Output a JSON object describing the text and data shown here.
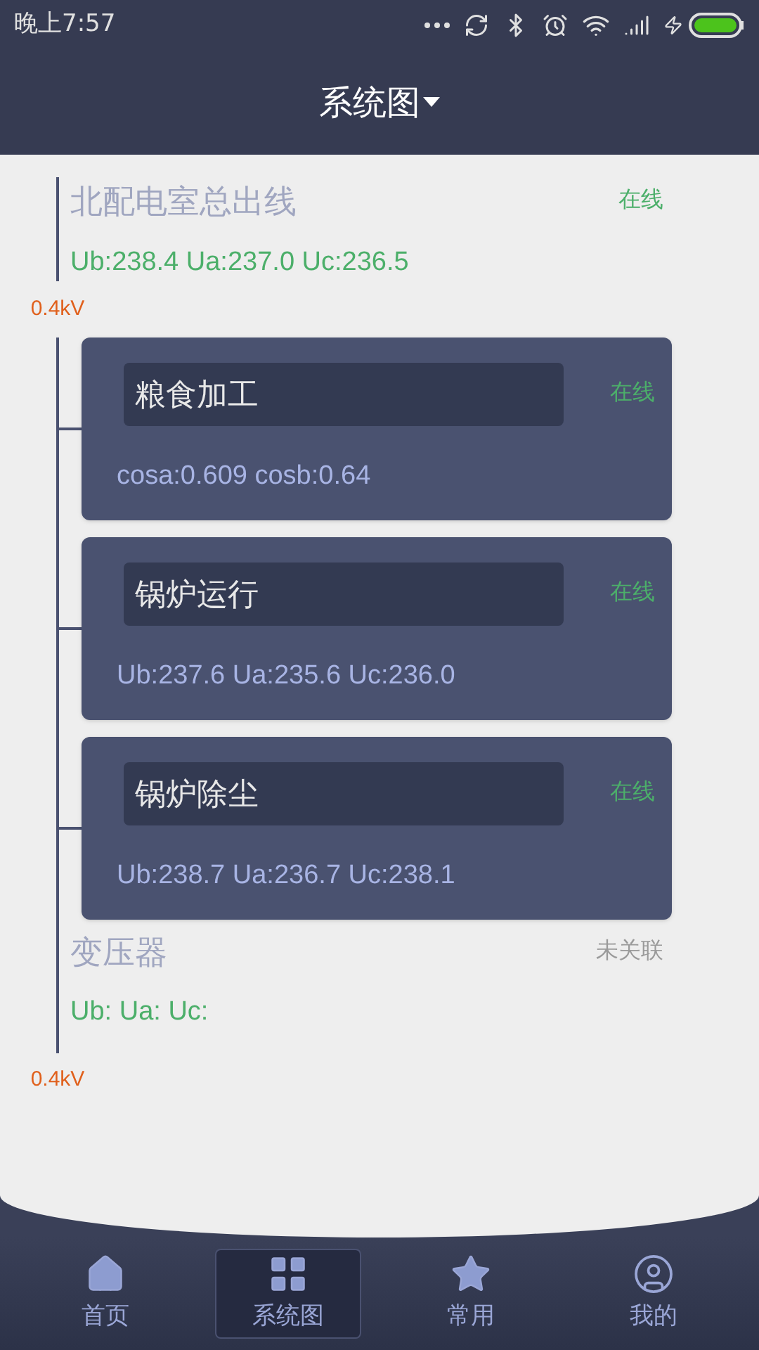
{
  "status_bar": {
    "time": "晚上7:57"
  },
  "header": {
    "title": "系统图"
  },
  "top_feeder": {
    "name": "北配电室总出线",
    "status": "在线",
    "online": true,
    "readings": "Ub:238.4 Ua:237.0 Uc:236.5",
    "bus_label": "0.4kV"
  },
  "loads": [
    {
      "name": "粮食加工",
      "status": "在线",
      "online": true,
      "readings": "cosa:0.609 cosb:0.64"
    },
    {
      "name": "锅炉运行",
      "status": "在线",
      "online": true,
      "readings": "Ub:237.6 Ua:235.6 Uc:236.0"
    },
    {
      "name": "锅炉除尘",
      "status": "在线",
      "online": true,
      "readings": "Ub:238.7 Ua:236.7 Uc:238.1"
    }
  ],
  "bottom_feeder": {
    "name": "变压器",
    "status": "未关联",
    "online": false,
    "readings": "Ub: Ua: Uc:",
    "bus_label": "0.4kV"
  },
  "nav": [
    {
      "label": "首页",
      "kind": "home",
      "selected": false
    },
    {
      "label": "系统图",
      "kind": "grid",
      "selected": true
    },
    {
      "label": "常用",
      "kind": "star",
      "selected": false
    },
    {
      "label": "我的",
      "kind": "user",
      "selected": false
    }
  ]
}
